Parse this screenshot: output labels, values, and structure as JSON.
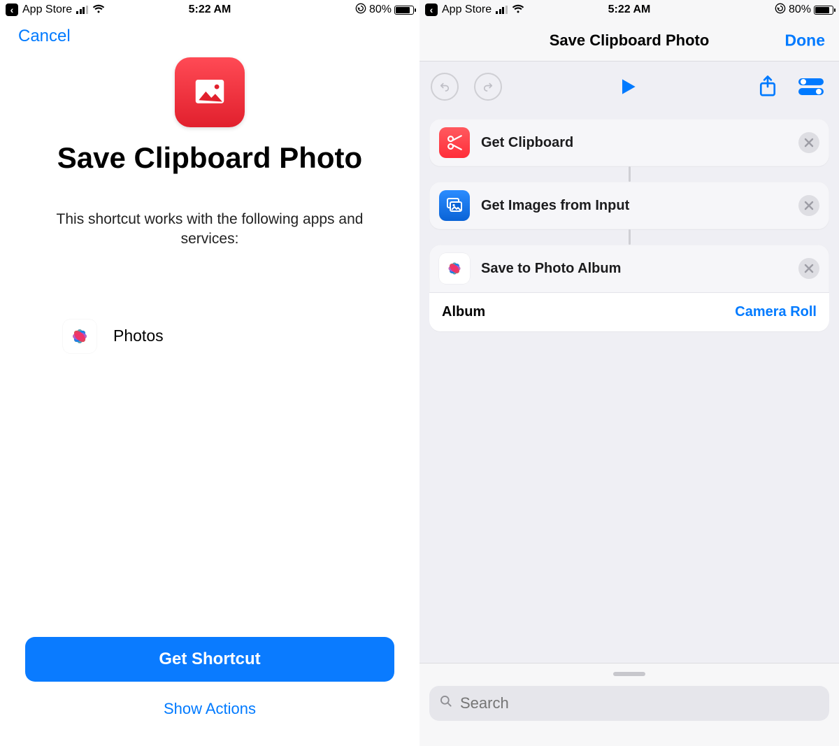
{
  "status_bar": {
    "back_label": "App Store",
    "time": "5:22 AM",
    "battery_pct": "80%"
  },
  "left": {
    "cancel": "Cancel",
    "title": "Save Clipboard Photo",
    "subtitle": "This shortcut works with the following apps and services:",
    "apps": [
      {
        "name": "Photos"
      }
    ],
    "primary": "Get Shortcut",
    "secondary": "Show Actions"
  },
  "right": {
    "title": "Save Clipboard Photo",
    "done": "Done",
    "actions": [
      {
        "title": "Get Clipboard"
      },
      {
        "title": "Get Images from Input"
      },
      {
        "title": "Save to Photo Album"
      }
    ],
    "album": {
      "label": "Album",
      "value": "Camera Roll"
    },
    "search_placeholder": "Search"
  }
}
